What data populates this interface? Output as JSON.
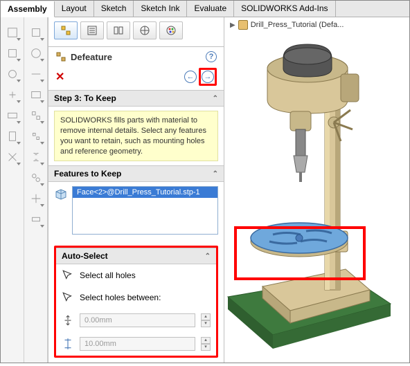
{
  "ribbon": {
    "tabs": [
      "Assembly",
      "Layout",
      "Sketch",
      "Sketch Ink",
      "Evaluate",
      "SOLIDWORKS Add-Ins"
    ],
    "active_index": 0
  },
  "panel": {
    "tabs": [
      "feature-tree",
      "property-manager",
      "configurations",
      "dimxpert",
      "appearances"
    ],
    "title": "Defeature",
    "help_glyph": "?",
    "close_glyph": "✕",
    "back_glyph": "←",
    "forward_glyph": "→",
    "step_title": "Step 3: To Keep",
    "instruction": "SOLIDWORKS fills parts with material to remove internal details. Select any features you want to retain, such as mounting holes and reference geometry.",
    "features_to_keep_title": "Features to Keep",
    "selection_items": [
      "Face<2>@Drill_Press_Tutorial.stp-1"
    ],
    "auto_select_title": "Auto-Select",
    "select_all_holes_label": "Select all holes",
    "select_holes_between_label": "Select holes between:",
    "min_value": "0.00mm",
    "max_value": "10.00mm"
  },
  "viewport": {
    "document_name": "Drill_Press_Tutorial  (Defa..."
  }
}
